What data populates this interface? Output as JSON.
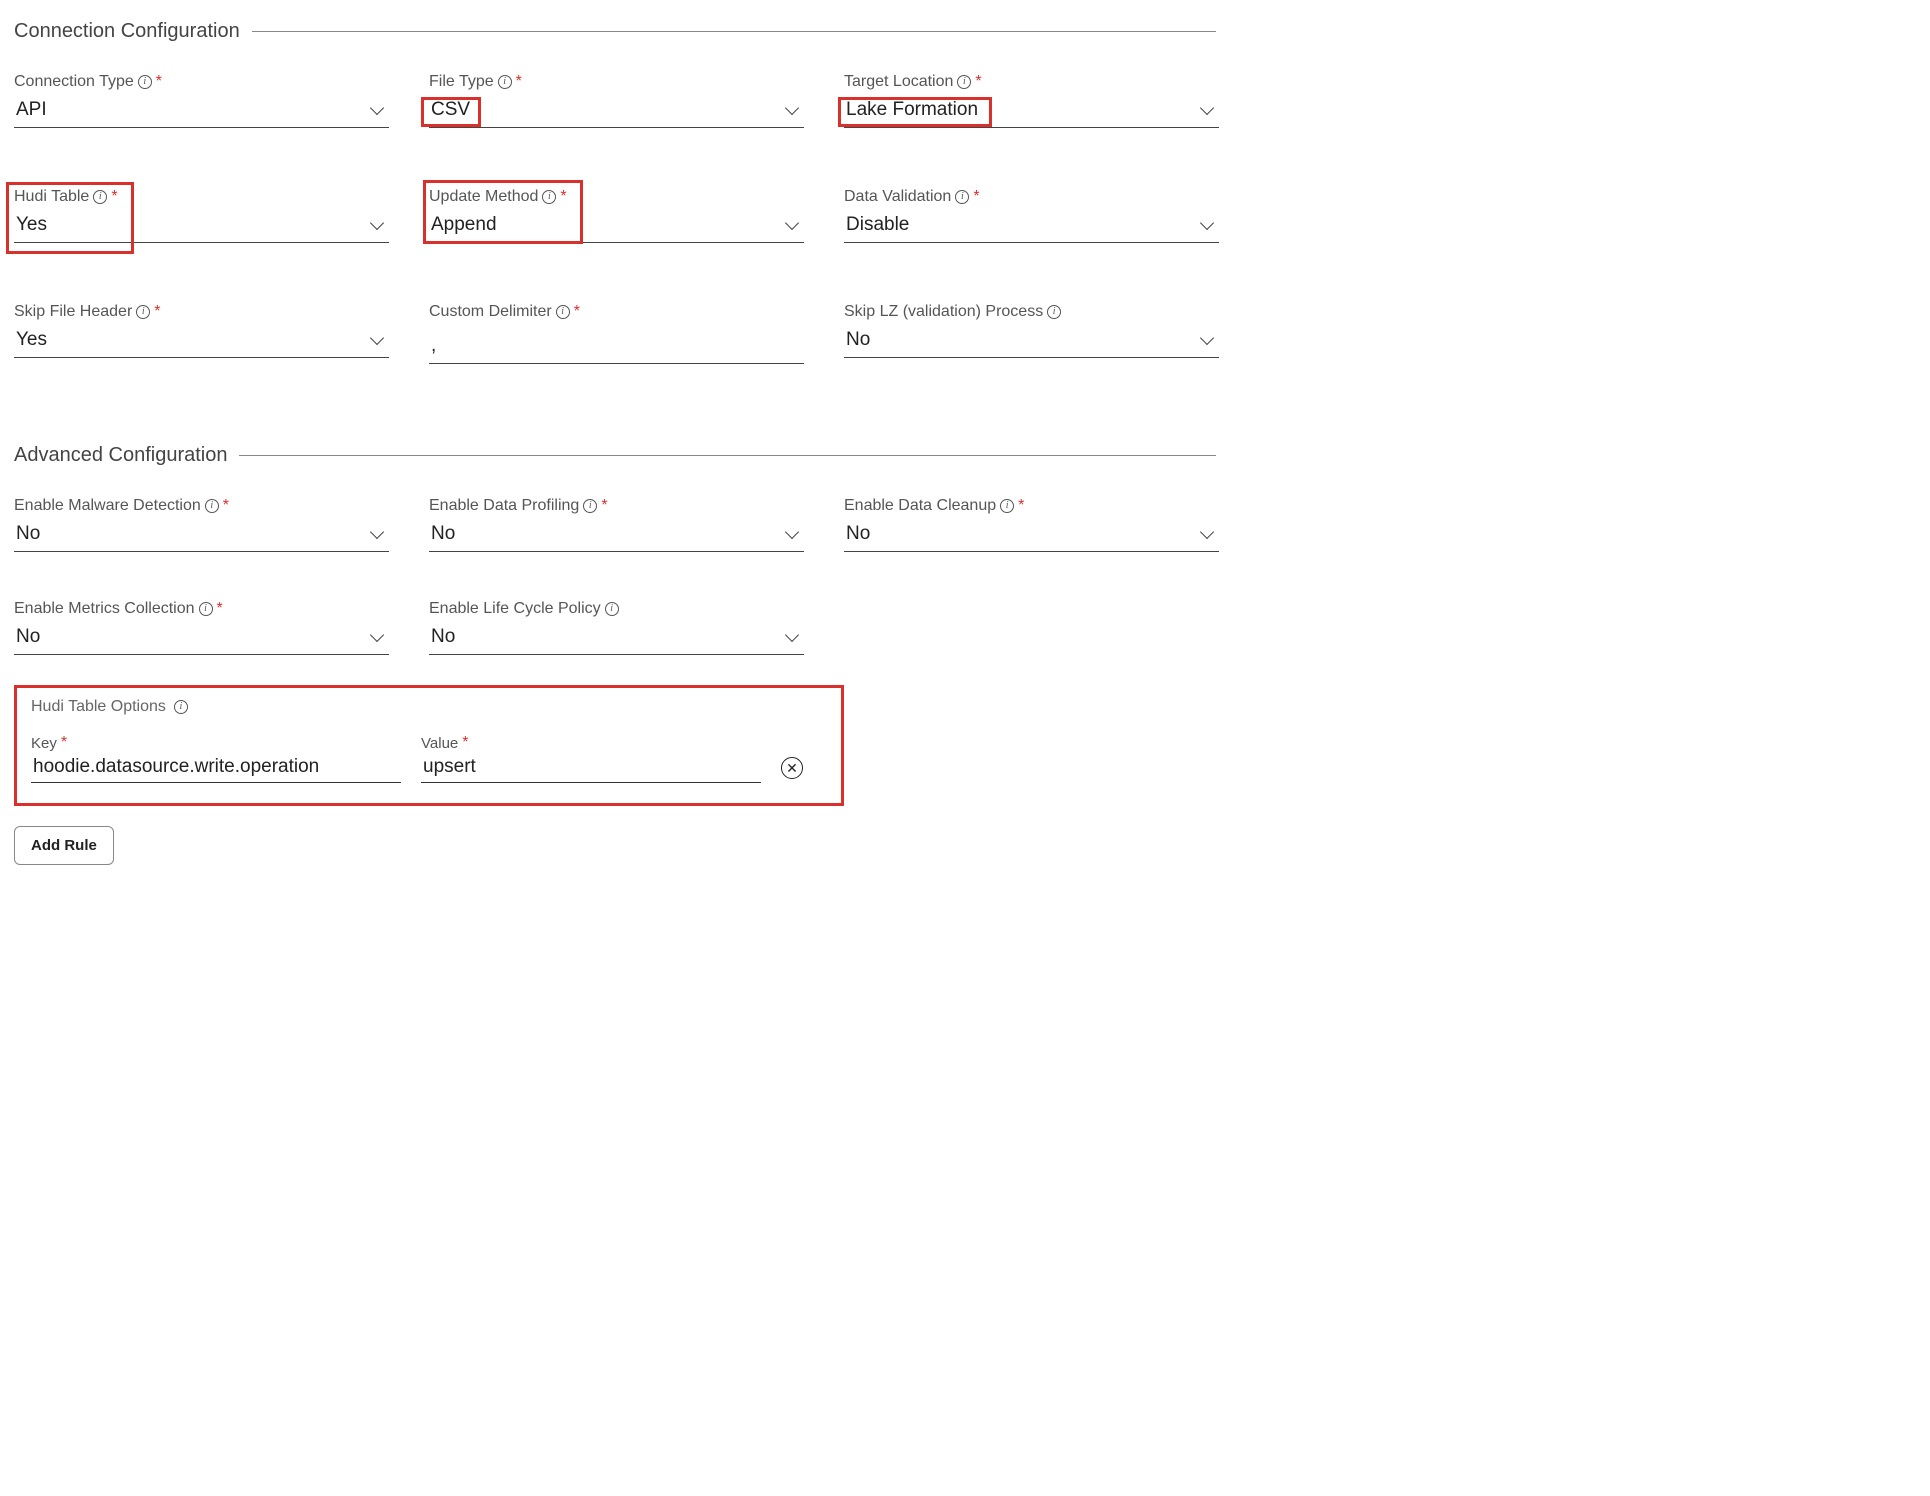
{
  "sections": {
    "connection": {
      "title": "Connection Configuration",
      "fields": {
        "connection_type": {
          "label": "Connection Type",
          "value": "API",
          "required": true
        },
        "file_type": {
          "label": "File Type",
          "value": "CSV",
          "required": true
        },
        "target_location": {
          "label": "Target Location",
          "value": "Lake Formation",
          "required": true
        },
        "hudi_table": {
          "label": "Hudi Table",
          "value": "Yes",
          "required": true
        },
        "update_method": {
          "label": "Update Method",
          "value": "Append",
          "required": true
        },
        "data_validation": {
          "label": "Data Validation",
          "value": "Disable",
          "required": true
        },
        "skip_file_header": {
          "label": "Skip File Header",
          "value": "Yes",
          "required": true
        },
        "custom_delimiter": {
          "label": "Custom Delimiter",
          "value": ",",
          "required": true
        },
        "skip_lz": {
          "label": "Skip LZ (validation) Process",
          "value": "No",
          "required": false
        }
      }
    },
    "advanced": {
      "title": "Advanced Configuration",
      "fields": {
        "malware": {
          "label": "Enable Malware Detection",
          "value": "No",
          "required": true
        },
        "profiling": {
          "label": "Enable Data Profiling",
          "value": "No",
          "required": true
        },
        "cleanup": {
          "label": "Enable Data Cleanup",
          "value": "No",
          "required": true
        },
        "metrics": {
          "label": "Enable Metrics Collection",
          "value": "No",
          "required": true
        },
        "lifecycle": {
          "label": "Enable Life Cycle Policy",
          "value": "No",
          "required": false
        }
      }
    }
  },
  "hudi_options": {
    "title": "Hudi Table Options",
    "key_label": "Key",
    "value_label": "Value",
    "rows": [
      {
        "key": "hoodie.datasource.write.operation",
        "value": "upsert"
      }
    ]
  },
  "buttons": {
    "add_rule": "Add Rule"
  },
  "glyphs": {
    "star": "*",
    "info": "i",
    "remove": "✕"
  }
}
